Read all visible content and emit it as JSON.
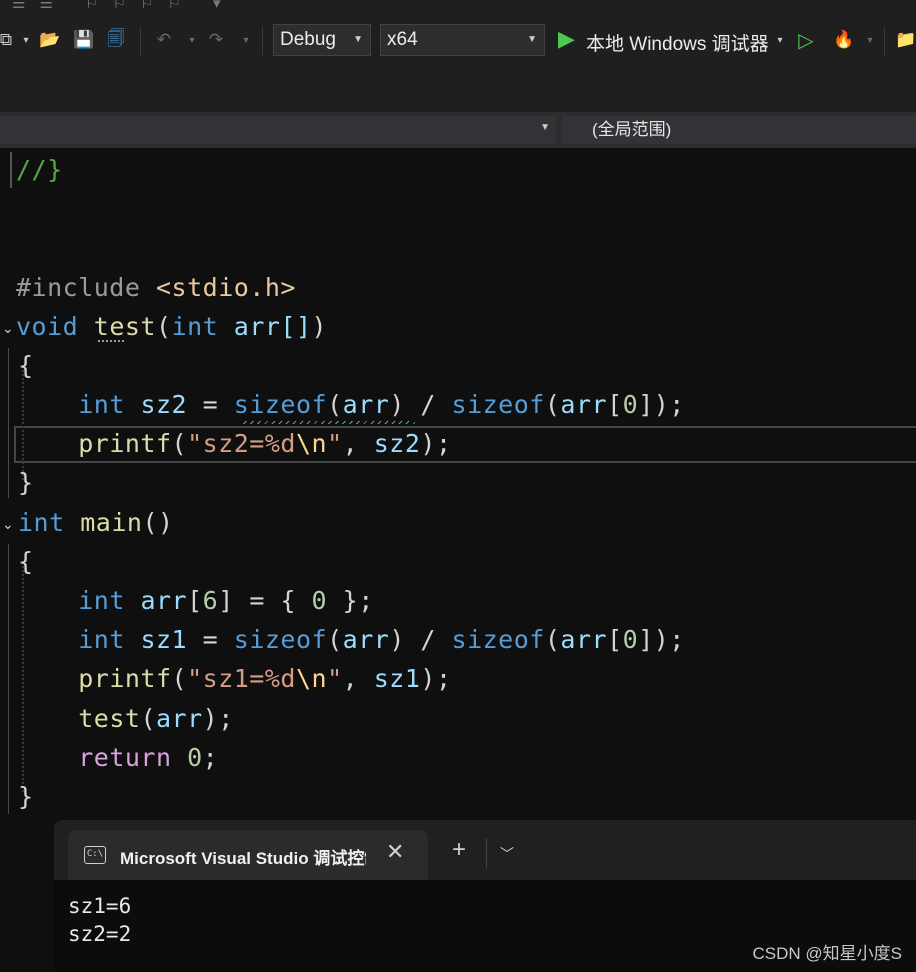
{
  "toolbar": {
    "config": "Debug",
    "platform": "x64",
    "run_label": "本地 Windows 调试器"
  },
  "navbar": {
    "scope": "(全局范围)"
  },
  "code": {
    "comment": "//}",
    "include_directive": "#include",
    "include_file": "<stdio.h>",
    "test_sig_type": "void",
    "test_name": "test",
    "test_param_type": "int",
    "test_param": "arr[]",
    "int_kw": "int",
    "sizeof_kw": "sizeof",
    "printf_fn": "printf",
    "return_kw": "return",
    "main_name": "main",
    "sz1": "sz1",
    "sz2": "sz2",
    "arr": "arr",
    "fmt1_a": "\"sz1=%d",
    "fmt2_a": "\"sz2=%d",
    "fmt_esc": "\\n",
    "fmt_end": "\"",
    "num0": "0",
    "num6": "6"
  },
  "console": {
    "tab_icon": "C:\\",
    "tab_title": "Microsoft Visual Studio 调试控制台",
    "output": [
      "sz1=6",
      "sz2=2"
    ]
  },
  "watermark": "CSDN @知星小度S"
}
